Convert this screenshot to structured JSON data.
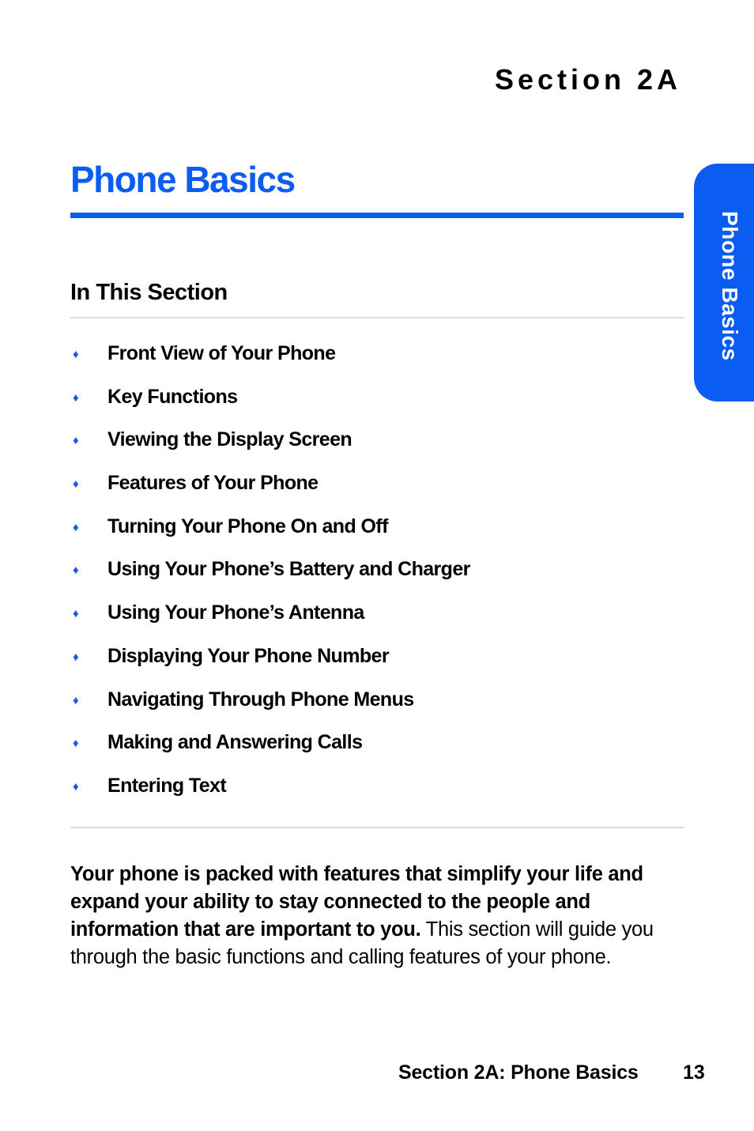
{
  "header": {
    "section_label": "Section 2A",
    "title": "Phone Basics"
  },
  "side_tab": {
    "label": "Phone Basics"
  },
  "in_this_section": {
    "heading": "In This Section",
    "bullet_icon": "diamond-bullet",
    "items": [
      {
        "label": "Front View of Your Phone"
      },
      {
        "label": "Key Functions"
      },
      {
        "label": "Viewing the Display Screen"
      },
      {
        "label": "Features of Your Phone"
      },
      {
        "label": "Turning Your Phone On and Off"
      },
      {
        "label": "Using Your Phone’s Battery and Charger"
      },
      {
        "label": "Using Your Phone’s Antenna"
      },
      {
        "label": "Displaying Your Phone Number"
      },
      {
        "label": "Navigating Through Phone Menus"
      },
      {
        "label": "Making and Answering Calls"
      },
      {
        "label": "Entering Text"
      }
    ]
  },
  "intro": {
    "bold_text": "Your phone is packed with features that simplify your life and expand your ability to stay connected to the people and information that are important to you.",
    "regular_text": " This section will guide you through the basic functions and calling features of your phone."
  },
  "footer": {
    "section_label": "Section 2A: Phone Basics",
    "page_number": "13"
  },
  "colors": {
    "accent": "#0b5cf0",
    "rule_gray": "#dcdcdc",
    "text": "#000000"
  }
}
